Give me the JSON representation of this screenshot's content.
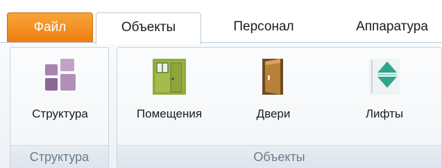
{
  "tabs": {
    "file": "Файл",
    "objects": "Объекты",
    "personnel": "Персонал",
    "hardware": "Аппаратура"
  },
  "groups": {
    "structure": {
      "label": "Структура",
      "buttons": [
        {
          "label": "Структура",
          "icon": "structure-icon"
        }
      ]
    },
    "objects": {
      "label": "Объекты",
      "buttons": [
        {
          "label": "Помещения",
          "icon": "rooms-icon"
        },
        {
          "label": "Двери",
          "icon": "door-icon"
        },
        {
          "label": "Лифты",
          "icon": "elevator-icon"
        }
      ]
    }
  },
  "colors": {
    "file_tab": "#ef7d0e",
    "structure_icon": "#9d7aa6",
    "rooms_icon": "#8ca33a",
    "door_icon": "#9b6a2b",
    "elevator_icon": "#2fa58c"
  }
}
